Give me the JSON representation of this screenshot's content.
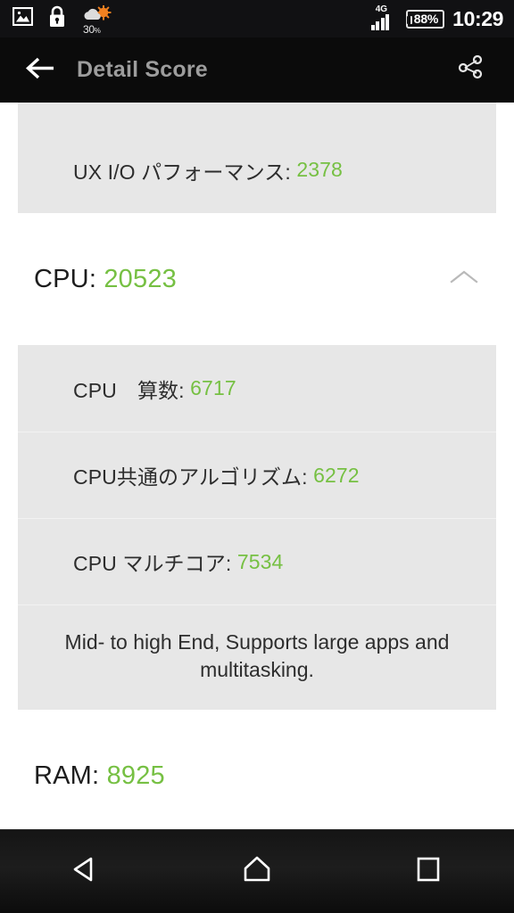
{
  "status_bar": {
    "left_icons": [
      {
        "name": "image-icon",
        "label": "image"
      },
      {
        "name": "lock-icon",
        "label": "lock"
      },
      {
        "name": "weather-icon",
        "label": "weather"
      }
    ],
    "weather_percent": "30",
    "weather_percent_unit": "%",
    "network_type": "4G",
    "signal_bars": 4,
    "battery": "88%",
    "time": "10:29"
  },
  "app_bar": {
    "back_icon": "arrow-left-icon",
    "title": "Detail Score",
    "share_icon": "share-icon"
  },
  "content": {
    "top_partial_section": {
      "visible": true
    },
    "ux_section": {
      "rows": [
        {
          "label": "UX I/O パフォーマンス: ",
          "value": "2378"
        }
      ]
    },
    "cpu_section": {
      "title_label": "CPU: ",
      "title_value": "20523",
      "chevron_icon": "chevron-up-icon",
      "rows": [
        {
          "label": "CPU　算数: ",
          "value": "6717"
        },
        {
          "label": "CPU共通のアルゴリズム: ",
          "value": "6272"
        },
        {
          "label": "CPU マルチコア: ",
          "value": "7534"
        }
      ],
      "description": "Mid- to high End, Supports large apps and multitasking."
    },
    "ram_section": {
      "title_label": "RAM: ",
      "title_value": "8925"
    }
  },
  "nav_bar": {
    "back": "back-triangle-icon",
    "home": "home-icon",
    "recents": "recents-square-icon"
  },
  "colors": {
    "accent_green": "#76c043",
    "status_bar_bg": "#111113",
    "app_bar_bg": "#0b0b0b",
    "panel_bg": "#e7e7e7",
    "title_gray": "#9d9d9d"
  }
}
